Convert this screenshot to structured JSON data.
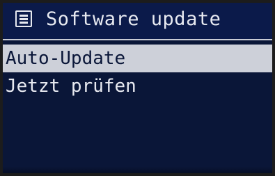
{
  "header": {
    "title": "Software update",
    "icon": "menu-list-icon"
  },
  "menu": {
    "items": [
      {
        "label": "Auto-Update",
        "selected": true
      },
      {
        "label": "Jetzt prüfen",
        "selected": false
      }
    ]
  },
  "colors": {
    "background": "#0a1638",
    "text": "#e8eaf1",
    "highlight": "#cdd0d9"
  }
}
